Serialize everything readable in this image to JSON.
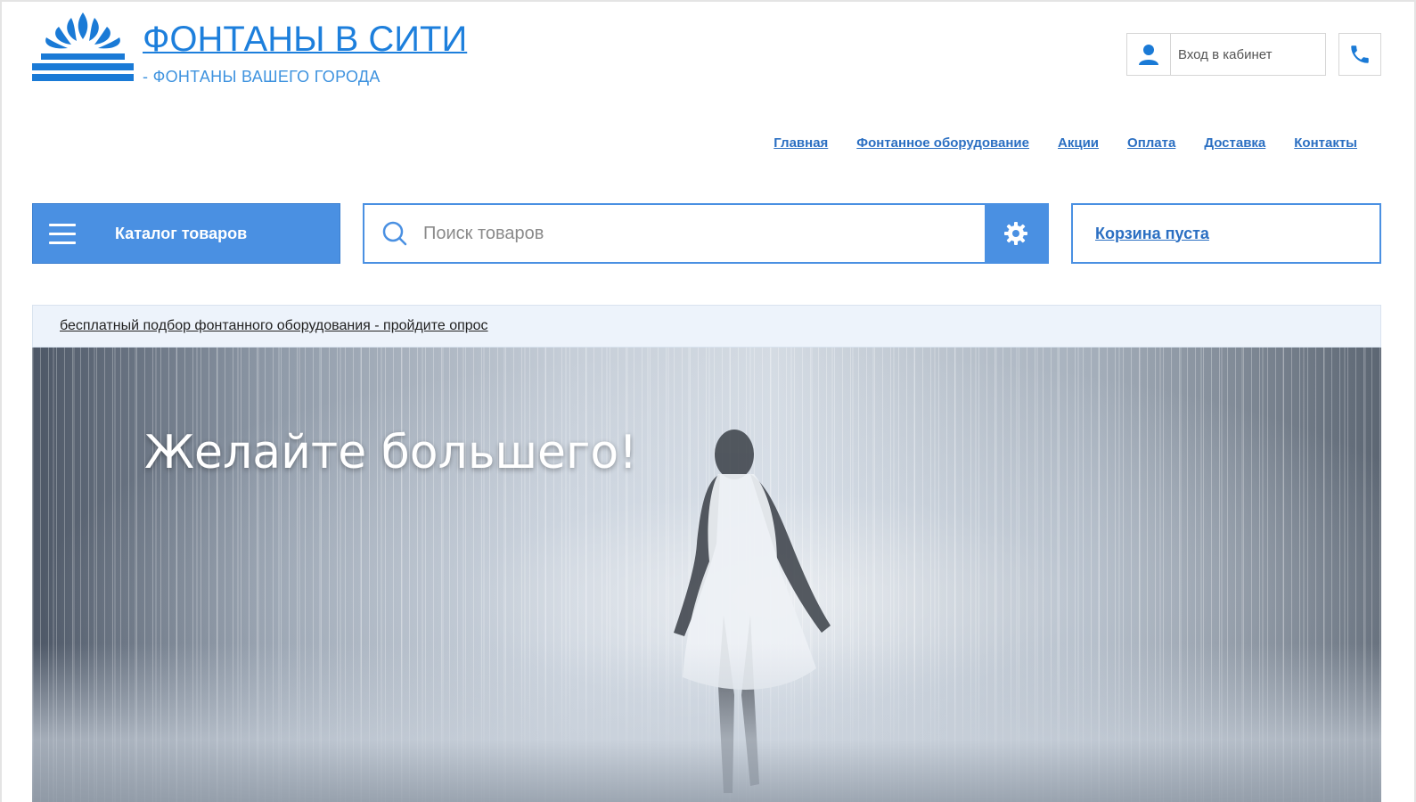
{
  "brand": {
    "title": "ФОНТАНЫ В СИТИ",
    "subtitle": "- ФОНТАНЫ ВАШЕГО ГОРОДА",
    "color": "#1d7fdc"
  },
  "header": {
    "cabinet_label": "Вход в кабинет",
    "cabinet_icon": "user-icon",
    "phone_icon": "phone-icon"
  },
  "nav": {
    "items": [
      {
        "label": "Главная"
      },
      {
        "label": "Фонтанное оборудование"
      },
      {
        "label": "Акции"
      },
      {
        "label": "Оплата"
      },
      {
        "label": "Доставка"
      },
      {
        "label": "Контакты"
      }
    ]
  },
  "toolbar": {
    "catalog_label": "Каталог товаров",
    "catalog_icon": "menu-icon",
    "search_placeholder": "Поиск товаров",
    "search_value": "",
    "search_icon": "search-icon",
    "settings_icon": "gear-icon",
    "cart_label": "Корзина пуста",
    "accent": "#4a90e2"
  },
  "promo": {
    "text": "бесплатный подбор фонтанного оборудования - пройдите опрос"
  },
  "hero": {
    "title": "Желайте большего!"
  }
}
